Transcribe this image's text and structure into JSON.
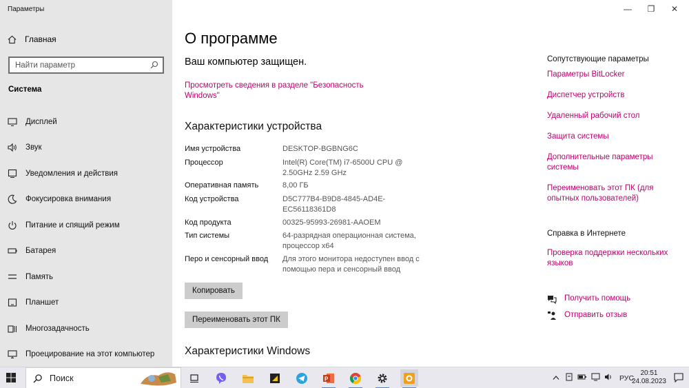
{
  "window": {
    "app_title": "Параметры",
    "minimize": "—",
    "maximize": "❐",
    "close": "✕"
  },
  "sidebar": {
    "home": "Главная",
    "search_placeholder": "Найти параметр",
    "section": "Система",
    "items": [
      {
        "label": "Дисплей",
        "icon": "monitor-icon"
      },
      {
        "label": "Звук",
        "icon": "speaker-icon"
      },
      {
        "label": "Уведомления и действия",
        "icon": "notification-icon"
      },
      {
        "label": "Фокусировка внимания",
        "icon": "moon-icon"
      },
      {
        "label": "Питание и спящий режим",
        "icon": "power-icon"
      },
      {
        "label": "Батарея",
        "icon": "battery-icon"
      },
      {
        "label": "Память",
        "icon": "storage-icon"
      },
      {
        "label": "Планшет",
        "icon": "tablet-icon"
      },
      {
        "label": "Многозадачность",
        "icon": "multitask-icon"
      },
      {
        "label": "Проецирование на этот компьютер",
        "icon": "project-icon"
      }
    ]
  },
  "main": {
    "title": "О программе",
    "protection": "Ваш компьютер защищен.",
    "security_link": "Просмотреть сведения в разделе \"Безопасность Windows\"",
    "device_heading": "Характеристики устройства",
    "specs": [
      {
        "key": "Имя устройства",
        "value": "DESKTOP-BGBNG6C"
      },
      {
        "key": "Процессор",
        "value": "Intel(R) Core(TM) i7-6500U CPU @ 2.50GHz   2.59 GHz"
      },
      {
        "key": "Оперативная память",
        "value": "8,00 ГБ"
      },
      {
        "key": "Код устройства",
        "value": "D5C777B4-B9D8-4845-AD4E-EC56118361D8"
      },
      {
        "key": "Код продукта",
        "value": "00325-95993-26981-AAOEM"
      },
      {
        "key": "Тип системы",
        "value": "64-разрядная операционная система, процессор x64"
      },
      {
        "key": "Перо и сенсорный ввод",
        "value": "Для этого монитора недоступен ввод с помощью пера и сенсорный ввод"
      }
    ],
    "copy_button": "Копировать",
    "rename_button": "Переименовать этот ПК",
    "windows_heading": "Характеристики Windows"
  },
  "related": {
    "heading": "Сопутствующие параметры",
    "links": [
      "Параметры BitLocker",
      "Диспетчер устройств",
      "Удаленный рабочий стол",
      "Защита системы",
      "Дополнительные параметры системы",
      "Переименовать этот ПК (для опытных пользователей)"
    ],
    "web_heading": "Справка в Интернете",
    "web_link": "Проверка поддержки нескольких языков",
    "get_help": "Получить помощь",
    "feedback": "Отправить отзыв"
  },
  "taskbar": {
    "search_label": "Поиск",
    "language": "РУС",
    "time": "20:51",
    "date": "24.08.2023",
    "apps": [
      "task-view-icon",
      "viber-icon",
      "file-explorer-icon",
      "sticky-app-icon",
      "telegram-icon",
      "powerpoint-icon",
      "chrome-icon",
      "settings-icon",
      "photo-app-icon"
    ]
  },
  "colors": {
    "link": "#c0006f",
    "sidebar_bg": "#e6e6e6",
    "button_bg": "#cccccc"
  }
}
